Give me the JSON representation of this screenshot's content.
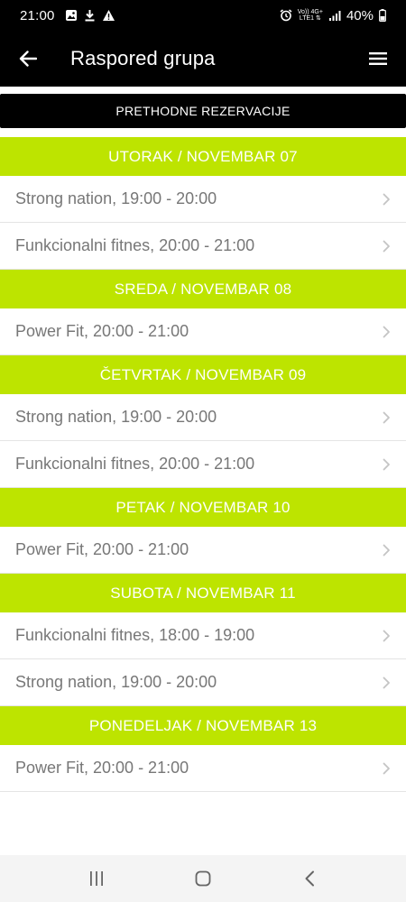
{
  "status_bar": {
    "time": "21:00",
    "network_top": "Vo)) 4G+",
    "network_bottom": "LTE1 ⇅",
    "battery": "40%"
  },
  "app_bar": {
    "title": "Raspored grupa"
  },
  "previous_button": {
    "label": "PRETHODNE REZERVACIJE"
  },
  "colors": {
    "accent": "#bde400",
    "bar": "#000000",
    "row_text": "#777777"
  },
  "days": [
    {
      "header": "UTORAK / NOVEMBAR 07",
      "sessions": [
        "Strong nation, 19:00 - 20:00",
        "Funkcionalni fitnes, 20:00 - 21:00"
      ]
    },
    {
      "header": "SREDA / NOVEMBAR 08",
      "sessions": [
        "Power Fit, 20:00 - 21:00"
      ]
    },
    {
      "header": "ČETVRTAK / NOVEMBAR 09",
      "sessions": [
        "Strong nation, 19:00 - 20:00",
        "Funkcionalni fitnes, 20:00 - 21:00"
      ]
    },
    {
      "header": "PETAK / NOVEMBAR 10",
      "sessions": [
        "Power Fit, 20:00 - 21:00"
      ]
    },
    {
      "header": "SUBOTA / NOVEMBAR 11",
      "sessions": [
        "Funkcionalni fitnes, 18:00 - 19:00",
        "Strong nation, 19:00 - 20:00"
      ]
    },
    {
      "header": "PONEDELJAK / NOVEMBAR 13",
      "sessions": [
        "Power Fit, 20:00 - 21:00"
      ]
    }
  ]
}
